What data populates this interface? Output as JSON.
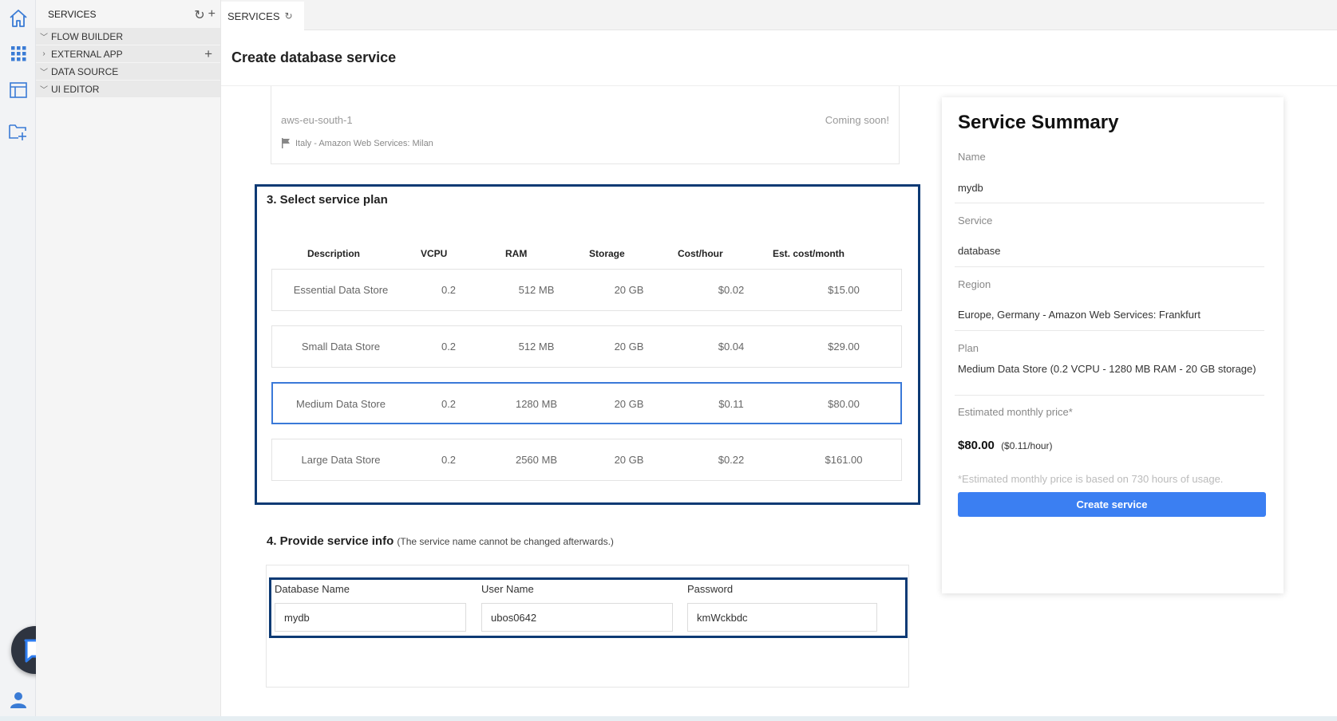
{
  "sidebar": {
    "header": "SERVICES",
    "items": [
      {
        "label": "FLOW BUILDER",
        "expanded": true
      },
      {
        "label": "EXTERNAL APP",
        "expanded": false
      },
      {
        "label": "DATA SOURCE",
        "expanded": true
      },
      {
        "label": "UI EDITOR",
        "expanded": true
      }
    ]
  },
  "tabs": [
    {
      "label": "SERVICES"
    }
  ],
  "page": {
    "title": "Create database service"
  },
  "region": {
    "code": "aws-eu-south-1",
    "status": "Coming soon!",
    "description": "Italy - Amazon Web Services: Milan"
  },
  "plans": {
    "title": "3. Select service plan",
    "columns": [
      "Description",
      "VCPU",
      "RAM",
      "Storage",
      "Cost/hour",
      "Est. cost/month"
    ],
    "rows": [
      [
        "Essential Data Store",
        "0.2",
        "512 MB",
        "20 GB",
        "$0.02",
        "$15.00"
      ],
      [
        "Small Data Store",
        "0.2",
        "512 MB",
        "20 GB",
        "$0.04",
        "$29.00"
      ],
      [
        "Medium Data Store",
        "0.2",
        "1280 MB",
        "20 GB",
        "$0.11",
        "$80.00"
      ],
      [
        "Large Data Store",
        "0.2",
        "2560 MB",
        "20 GB",
        "$0.22",
        "$161.00"
      ]
    ],
    "selected_index": 2
  },
  "service_info": {
    "title": "4. Provide service info",
    "note": "(The service name cannot be changed afterwards.)",
    "fields": [
      {
        "label": "Database Name",
        "value": "mydb"
      },
      {
        "label": "User Name",
        "value": "ubos0642"
      },
      {
        "label": "Password",
        "value": "kmWckbdc"
      }
    ]
  },
  "summary": {
    "title": "Service Summary",
    "name_label": "Name",
    "name_value": "mydb",
    "service_label": "Service",
    "service_value": "database",
    "region_label": "Region",
    "region_value": "Europe, Germany - Amazon Web Services: Frankfurt",
    "plan_label": "Plan",
    "plan_value": "Medium Data Store (0.2 VCPU - 1280 MB RAM - 20 GB storage)",
    "price_label": "Estimated monthly price*",
    "price_value": "$80.00",
    "price_hourly": "($0.11/hour)",
    "note": "*Estimated monthly price is based on 730 hours of usage.",
    "button_label": "Create service"
  },
  "colors": {
    "accent": "#3b7ff2",
    "highlight_border": "#0d3a74",
    "selected_row": "#3a79d8",
    "rail_icon": "#3a7bd5"
  }
}
